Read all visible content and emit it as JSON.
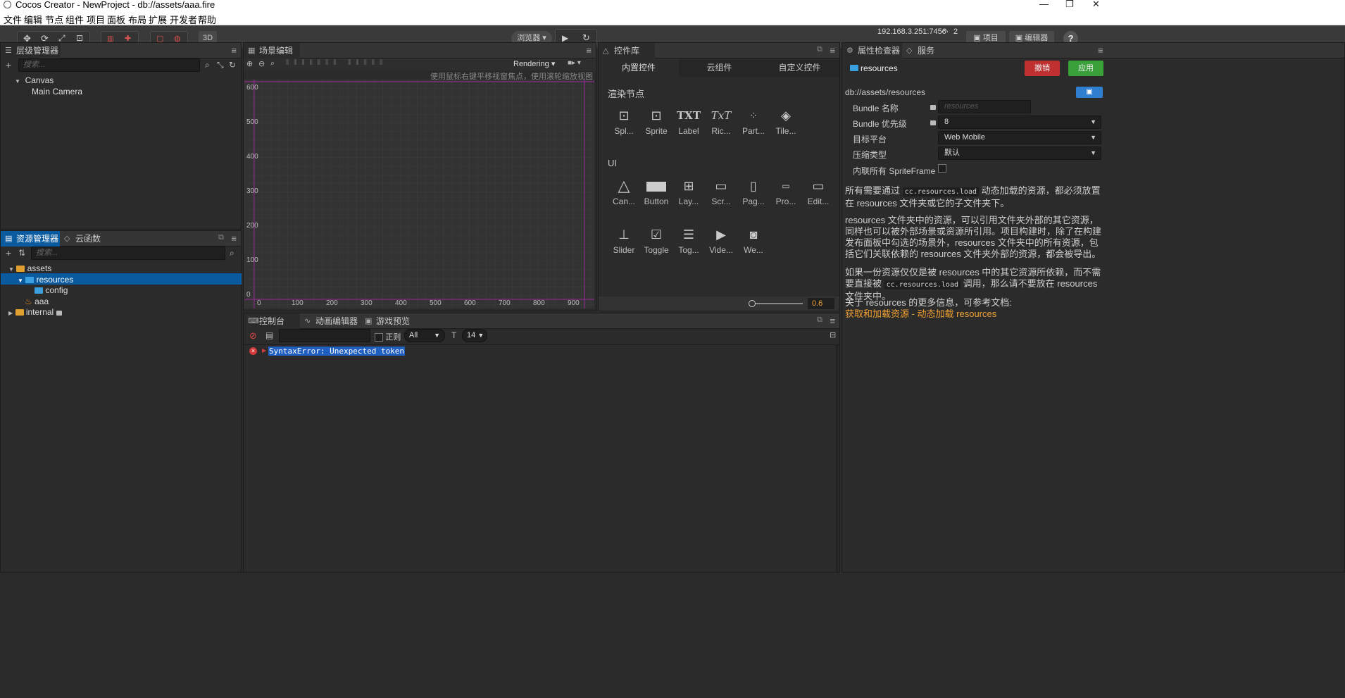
{
  "window": {
    "title": "Cocos Creator - NewProject - db://assets/aaa.fire"
  },
  "menu": [
    "文件",
    "编辑",
    "节点",
    "组件",
    "项目",
    "面板",
    "布局",
    "扩展",
    "开发者",
    "帮助"
  ],
  "toolbar": {
    "browser_label": "浏览器 ▾",
    "mode_3d": "3D",
    "ip": "192.168.3.251:7456",
    "connections": "2",
    "project_btn": "项目",
    "editor_btn": "编辑器",
    "help": "?"
  },
  "hierarchy": {
    "tab": "层级管理器",
    "search_placeholder": "搜索...",
    "nodes": [
      "Canvas",
      "Main Camera"
    ]
  },
  "assets": {
    "tab": "资源管理器",
    "tab2": "云函数",
    "search_placeholder": "搜索...",
    "items": [
      "assets",
      "resources",
      "config",
      "aaa",
      "internal"
    ]
  },
  "scene": {
    "tab": "场景编辑器",
    "rendering": "Rendering",
    "hint": "使用鼠标右键平移视窗焦点，使用滚轮缩放视图",
    "y_ticks": [
      "600",
      "500",
      "400",
      "300",
      "200",
      "100",
      "0"
    ],
    "x_ticks": [
      "0",
      "100",
      "200",
      "300",
      "400",
      "500",
      "600",
      "700",
      "800",
      "900"
    ]
  },
  "controls": {
    "tab": "控件库",
    "subtabs": [
      "内置控件",
      "云组件",
      "自定义控件"
    ],
    "render_section": "渲染节点",
    "ui_section": "UI",
    "render_items": [
      "Spl...",
      "Sprite",
      "Label",
      "Ric...",
      "Part...",
      "Tile..."
    ],
    "ui_items_row1": [
      "Can...",
      "Button",
      "Lay...",
      "Scr...",
      "Pag...",
      "Pro...",
      "Edit..."
    ],
    "ui_items_row2": [
      "Slider",
      "Toggle",
      "Tog...",
      "Vide...",
      "We..."
    ],
    "zoom_value": "0.6"
  },
  "console": {
    "tabs": [
      "控制台",
      "动画编辑器",
      "游戏预览"
    ],
    "regex_label": "正则",
    "level": "All",
    "font_size": "14",
    "error": "SyntaxError: Unexpected token"
  },
  "inspector": {
    "tab": "属性检查器",
    "tab2": "服务",
    "asset_name": "resources",
    "revert": "撤销",
    "apply": "应用",
    "path": "db://assets/resources",
    "fields": {
      "bundle_name_label": "Bundle 名称",
      "bundle_name_placeholder": "resources",
      "priority_label": "Bundle 优先级",
      "priority_value": "8",
      "platform_label": "目标平台",
      "platform_value": "Web Mobile",
      "compress_label": "压缩类型",
      "compress_value": "默认",
      "inline_label": "内联所有 SpriteFrame"
    },
    "para1_a": "所有需要通过",
    "para1_code": "cc.resources.load",
    "para1_b": "动态加载的资源，都必须放置在 resources 文件夹或它的子文件夹下。",
    "para2": "resources 文件夹中的资源，可以引用文件夹外部的其它资源，同样也可以被外部场景或资源所引用。项目构建时，除了在构建发布面板中勾选的场景外，resources 文件夹中的所有资源，包括它们关联依赖的 resources 文件夹外部的资源，都会被导出。",
    "para3_a": "如果一份资源仅仅是被 resources 中的其它资源所依赖，而不需要直接被",
    "para3_code": "cc.resources.load",
    "para3_b": "调用，那么请不要放在 resources 文件夹中。",
    "para4": "关于 resources 的更多信息，可参考文档:",
    "link": "获取和加载资源 - 动态加载 resources"
  }
}
